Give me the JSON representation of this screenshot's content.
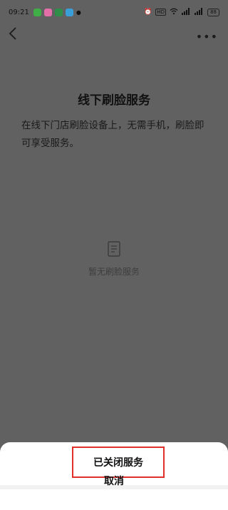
{
  "status_bar": {
    "time": "09:21",
    "battery": "88",
    "network": "HD"
  },
  "page": {
    "title": "线下刷脸服务",
    "description": "在线下门店刷脸设备上，无需手机，刷脸即可享受服务。",
    "empty_text": "暂无刷脸服务"
  },
  "sheet": {
    "action_label": "已关闭服务",
    "cancel_label": "取消"
  },
  "colors": {
    "overlay": "#616161",
    "highlight_border": "#e0302a",
    "sheet_bg": "#ffffff"
  },
  "icons": {
    "back": "back-arrow-icon",
    "more": "more-dots-icon",
    "empty": "document-icon"
  }
}
